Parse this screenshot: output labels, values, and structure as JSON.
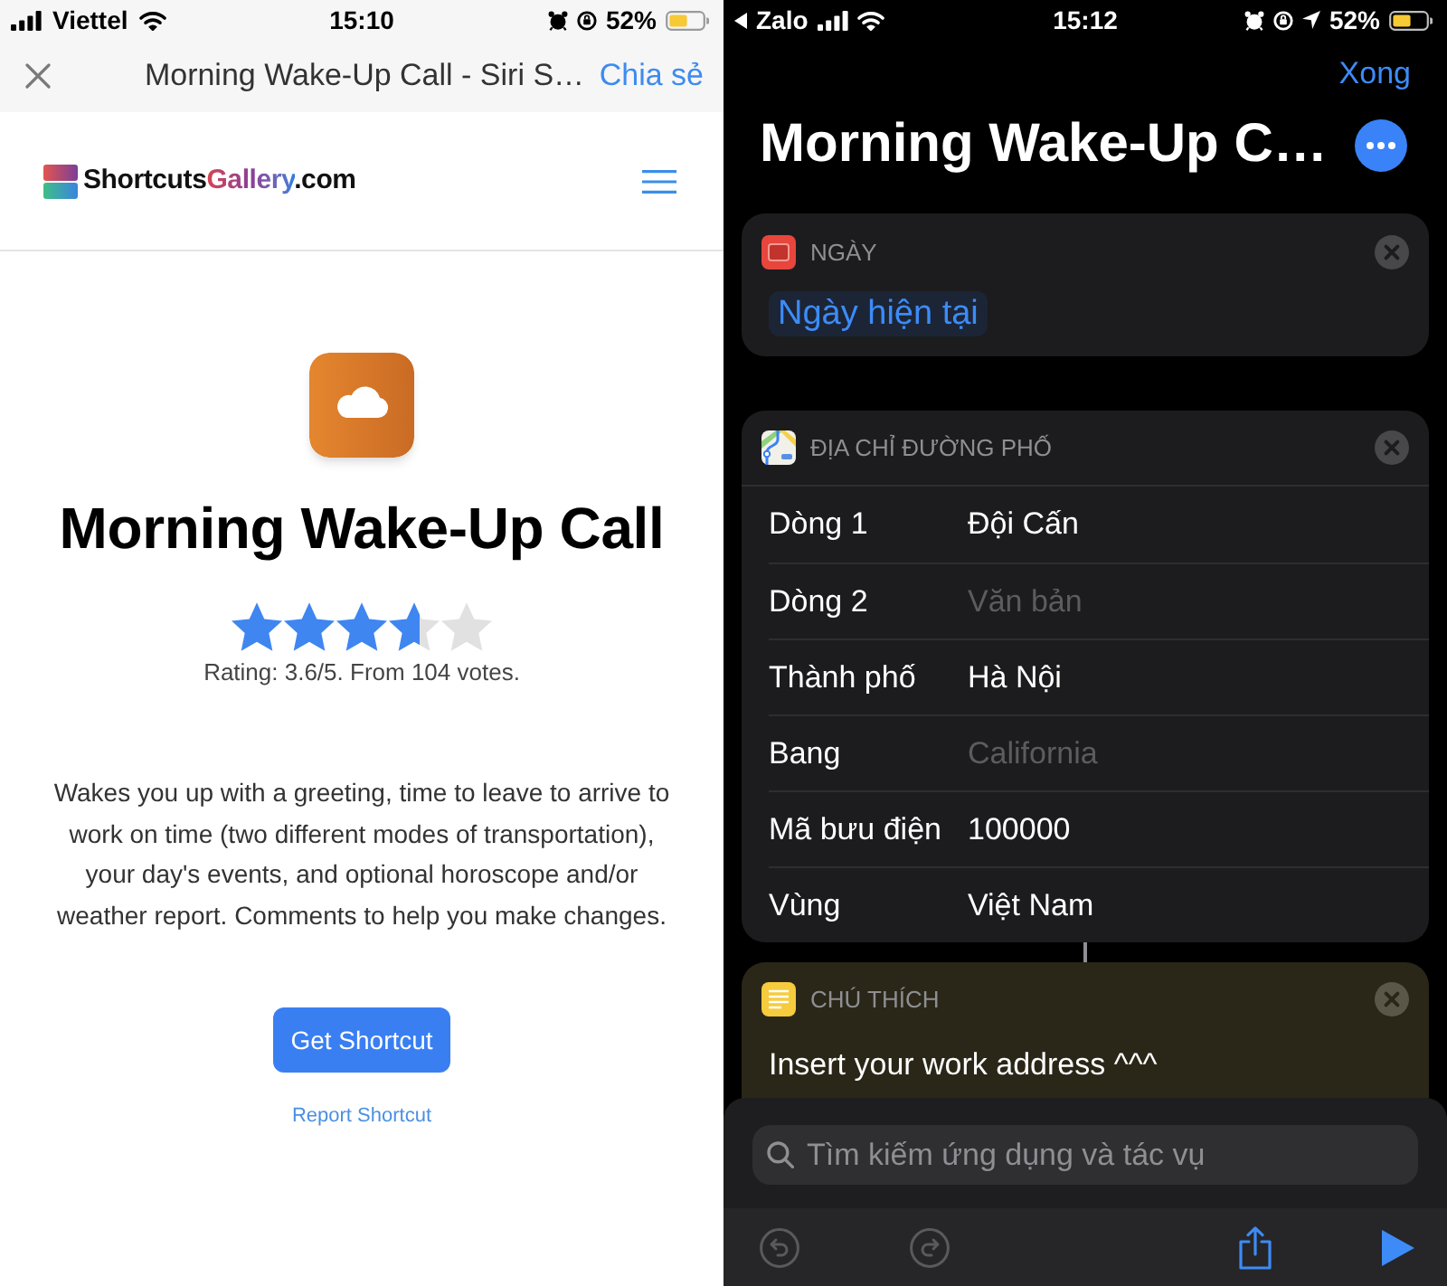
{
  "left_screen": {
    "status_bar": {
      "carrier": "Viettel",
      "time": "15:10",
      "battery": "52%"
    },
    "nav_bar": {
      "title": "Morning Wake-Up Call - Siri S…",
      "action": "Chia sẻ"
    },
    "site_header": {
      "logo_parts": [
        {
          "text": "Shortcuts",
          "kind": "plain"
        },
        {
          "text": "Gallery",
          "kind": "accent"
        },
        {
          "text": ".com",
          "kind": "plain"
        }
      ]
    },
    "shortcut": {
      "title": "Morning Wake-Up Call",
      "stars": 3.6,
      "rating_text": "Rating: 3.6/5. From 104 votes.",
      "description": "Wakes you up with a greeting, time to leave to arrive to work on time (two different modes of transportation), your day's events, and optional horoscope and/or weather report. Comments to help you make changes.",
      "button": "Get Shortcut",
      "report_link": "Report Shortcut"
    }
  },
  "right_screen": {
    "status_bar": {
      "back_app": "Zalo",
      "time": "15:12",
      "battery": "52%"
    },
    "done_button": "Xong",
    "title": "Morning Wake-Up C…",
    "actions": [
      {
        "kind": "date",
        "header": "NGÀY",
        "linked_to_previous": false,
        "token": "Ngày hiện tại"
      },
      {
        "kind": "address",
        "header": "ĐỊA CHỈ ĐƯỜNG PHỐ",
        "linked_to_previous": false,
        "fields": [
          {
            "label": "Dòng 1",
            "value": "Đội Cấn"
          },
          {
            "label": "Dòng 2",
            "placeholder": "Văn bản"
          },
          {
            "label": "Thành phố",
            "value": "Hà Nội"
          },
          {
            "label": "Bang",
            "placeholder": "California"
          },
          {
            "label": "Mã bưu điện",
            "value": "100000"
          },
          {
            "label": "Vùng",
            "value": "Việt Nam"
          }
        ]
      },
      {
        "kind": "comment",
        "header": "CHÚ THÍCH",
        "linked_to_previous": true,
        "text": "Insert your work address ^^^"
      }
    ],
    "search": {
      "placeholder": "Tìm kiếm ứng dụng và tác vụ"
    },
    "toolbar": [
      {
        "kind": "undo",
        "disabled": true
      },
      {
        "kind": "redo",
        "disabled": true
      },
      {
        "kind": "share",
        "disabled": false
      },
      {
        "kind": "play",
        "disabled": false
      }
    ]
  }
}
